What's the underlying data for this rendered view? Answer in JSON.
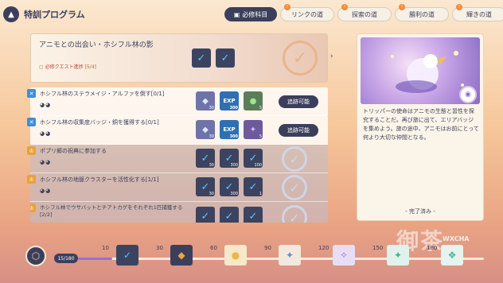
{
  "header": {
    "title": "特訓プログラム",
    "tabs": [
      {
        "label": "必修科目",
        "active": true,
        "badge": ""
      },
      {
        "label": "リンクの道",
        "active": false,
        "badge": "!"
      },
      {
        "label": "探索の道",
        "active": false,
        "badge": "!"
      },
      {
        "label": "勝利の道",
        "active": false,
        "badge": "!"
      },
      {
        "label": "輝きの道",
        "active": false,
        "badge": "!"
      }
    ]
  },
  "featured": {
    "title": "アニモとの出会い・ホシフル林の影",
    "sub_label": "必修クエスト進捗",
    "progress": "[5/4]"
  },
  "quests": [
    {
      "name": "ホシフル林のステラメイジ・アルファを倒す[0/1]",
      "eyes": "◕◕",
      "button": "追跡可能",
      "rewards": [
        {
          "num": "30"
        },
        {
          "label": "EXP",
          "num": "300"
        },
        {
          "num": "5"
        }
      ]
    },
    {
      "name": "ホシフル林の収集度バッジ・銅を獲得する[0/1]",
      "eyes": "◕◕",
      "button": "追跡可能",
      "rewards": [
        {
          "num": "30"
        },
        {
          "label": "EXP",
          "num": "300"
        },
        {
          "num": "5"
        }
      ]
    },
    {
      "name": "ポプリ郷の祝典に参加する",
      "eyes": "◕◕",
      "rewards": [
        {
          "num": "30"
        },
        {
          "num": "300"
        },
        {
          "num": "100"
        }
      ]
    },
    {
      "name": "ホシフル林の地脈クラスターを活性化する[1/1]",
      "eyes": "◕◕",
      "rewards": [
        {
          "num": "30"
        },
        {
          "num": "300"
        },
        {
          "num": "1"
        }
      ]
    },
    {
      "name": "ホシフル林でウサバットとチアトカゲをそれぞれ1匹捕獲する[2/2]",
      "eyes": "",
      "rewards": [
        {
          "num": ""
        },
        {
          "num": ""
        },
        {
          "num": ""
        }
      ]
    }
  ],
  "panel": {
    "description": "トリッパーの使命はアニモの生態と習性を探究することだ。再び旅に出て、エリアバッジを集めよう。旅の途中、アニモはお前にとって何より大切な仲間となる。",
    "status": "- 完了済み -"
  },
  "progress": {
    "label": "15/180",
    "value": 15,
    "max": 180,
    "milestones": [
      {
        "num": "10",
        "icon": "✓"
      },
      {
        "num": "30",
        "icon": "◆"
      },
      {
        "num": "60",
        "icon": "●"
      },
      {
        "num": "90",
        "icon": "✦"
      },
      {
        "num": "120",
        "icon": "✧"
      },
      {
        "num": "150",
        "icon": "✦"
      },
      {
        "num": "180",
        "icon": "❖"
      }
    ]
  },
  "watermark": {
    "text": "御茶",
    "sub": "WXCHA"
  }
}
